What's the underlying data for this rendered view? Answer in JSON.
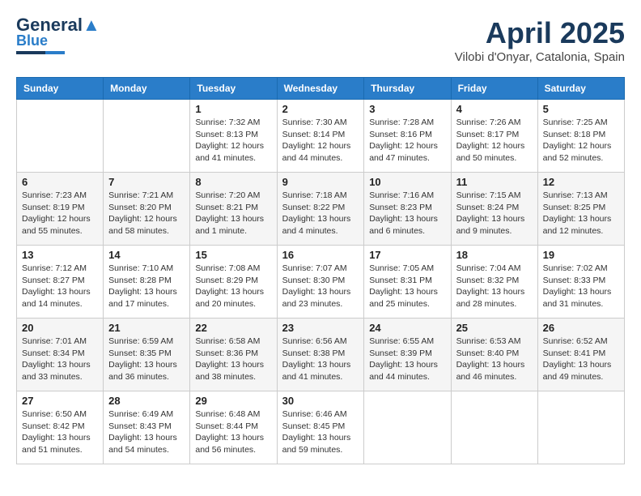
{
  "header": {
    "logo_line1": "General",
    "logo_line2": "Blue",
    "month_title": "April 2025",
    "location": "Vilobi d'Onyar, Catalonia, Spain"
  },
  "weekdays": [
    "Sunday",
    "Monday",
    "Tuesday",
    "Wednesday",
    "Thursday",
    "Friday",
    "Saturday"
  ],
  "weeks": [
    [
      {
        "day": "",
        "info": ""
      },
      {
        "day": "",
        "info": ""
      },
      {
        "day": "1",
        "info": "Sunrise: 7:32 AM\nSunset: 8:13 PM\nDaylight: 12 hours\nand 41 minutes."
      },
      {
        "day": "2",
        "info": "Sunrise: 7:30 AM\nSunset: 8:14 PM\nDaylight: 12 hours\nand 44 minutes."
      },
      {
        "day": "3",
        "info": "Sunrise: 7:28 AM\nSunset: 8:16 PM\nDaylight: 12 hours\nand 47 minutes."
      },
      {
        "day": "4",
        "info": "Sunrise: 7:26 AM\nSunset: 8:17 PM\nDaylight: 12 hours\nand 50 minutes."
      },
      {
        "day": "5",
        "info": "Sunrise: 7:25 AM\nSunset: 8:18 PM\nDaylight: 12 hours\nand 52 minutes."
      }
    ],
    [
      {
        "day": "6",
        "info": "Sunrise: 7:23 AM\nSunset: 8:19 PM\nDaylight: 12 hours\nand 55 minutes."
      },
      {
        "day": "7",
        "info": "Sunrise: 7:21 AM\nSunset: 8:20 PM\nDaylight: 12 hours\nand 58 minutes."
      },
      {
        "day": "8",
        "info": "Sunrise: 7:20 AM\nSunset: 8:21 PM\nDaylight: 13 hours\nand 1 minute."
      },
      {
        "day": "9",
        "info": "Sunrise: 7:18 AM\nSunset: 8:22 PM\nDaylight: 13 hours\nand 4 minutes."
      },
      {
        "day": "10",
        "info": "Sunrise: 7:16 AM\nSunset: 8:23 PM\nDaylight: 13 hours\nand 6 minutes."
      },
      {
        "day": "11",
        "info": "Sunrise: 7:15 AM\nSunset: 8:24 PM\nDaylight: 13 hours\nand 9 minutes."
      },
      {
        "day": "12",
        "info": "Sunrise: 7:13 AM\nSunset: 8:25 PM\nDaylight: 13 hours\nand 12 minutes."
      }
    ],
    [
      {
        "day": "13",
        "info": "Sunrise: 7:12 AM\nSunset: 8:27 PM\nDaylight: 13 hours\nand 14 minutes."
      },
      {
        "day": "14",
        "info": "Sunrise: 7:10 AM\nSunset: 8:28 PM\nDaylight: 13 hours\nand 17 minutes."
      },
      {
        "day": "15",
        "info": "Sunrise: 7:08 AM\nSunset: 8:29 PM\nDaylight: 13 hours\nand 20 minutes."
      },
      {
        "day": "16",
        "info": "Sunrise: 7:07 AM\nSunset: 8:30 PM\nDaylight: 13 hours\nand 23 minutes."
      },
      {
        "day": "17",
        "info": "Sunrise: 7:05 AM\nSunset: 8:31 PM\nDaylight: 13 hours\nand 25 minutes."
      },
      {
        "day": "18",
        "info": "Sunrise: 7:04 AM\nSunset: 8:32 PM\nDaylight: 13 hours\nand 28 minutes."
      },
      {
        "day": "19",
        "info": "Sunrise: 7:02 AM\nSunset: 8:33 PM\nDaylight: 13 hours\nand 31 minutes."
      }
    ],
    [
      {
        "day": "20",
        "info": "Sunrise: 7:01 AM\nSunset: 8:34 PM\nDaylight: 13 hours\nand 33 minutes."
      },
      {
        "day": "21",
        "info": "Sunrise: 6:59 AM\nSunset: 8:35 PM\nDaylight: 13 hours\nand 36 minutes."
      },
      {
        "day": "22",
        "info": "Sunrise: 6:58 AM\nSunset: 8:36 PM\nDaylight: 13 hours\nand 38 minutes."
      },
      {
        "day": "23",
        "info": "Sunrise: 6:56 AM\nSunset: 8:38 PM\nDaylight: 13 hours\nand 41 minutes."
      },
      {
        "day": "24",
        "info": "Sunrise: 6:55 AM\nSunset: 8:39 PM\nDaylight: 13 hours\nand 44 minutes."
      },
      {
        "day": "25",
        "info": "Sunrise: 6:53 AM\nSunset: 8:40 PM\nDaylight: 13 hours\nand 46 minutes."
      },
      {
        "day": "26",
        "info": "Sunrise: 6:52 AM\nSunset: 8:41 PM\nDaylight: 13 hours\nand 49 minutes."
      }
    ],
    [
      {
        "day": "27",
        "info": "Sunrise: 6:50 AM\nSunset: 8:42 PM\nDaylight: 13 hours\nand 51 minutes."
      },
      {
        "day": "28",
        "info": "Sunrise: 6:49 AM\nSunset: 8:43 PM\nDaylight: 13 hours\nand 54 minutes."
      },
      {
        "day": "29",
        "info": "Sunrise: 6:48 AM\nSunset: 8:44 PM\nDaylight: 13 hours\nand 56 minutes."
      },
      {
        "day": "30",
        "info": "Sunrise: 6:46 AM\nSunset: 8:45 PM\nDaylight: 13 hours\nand 59 minutes."
      },
      {
        "day": "",
        "info": ""
      },
      {
        "day": "",
        "info": ""
      },
      {
        "day": "",
        "info": ""
      }
    ]
  ]
}
